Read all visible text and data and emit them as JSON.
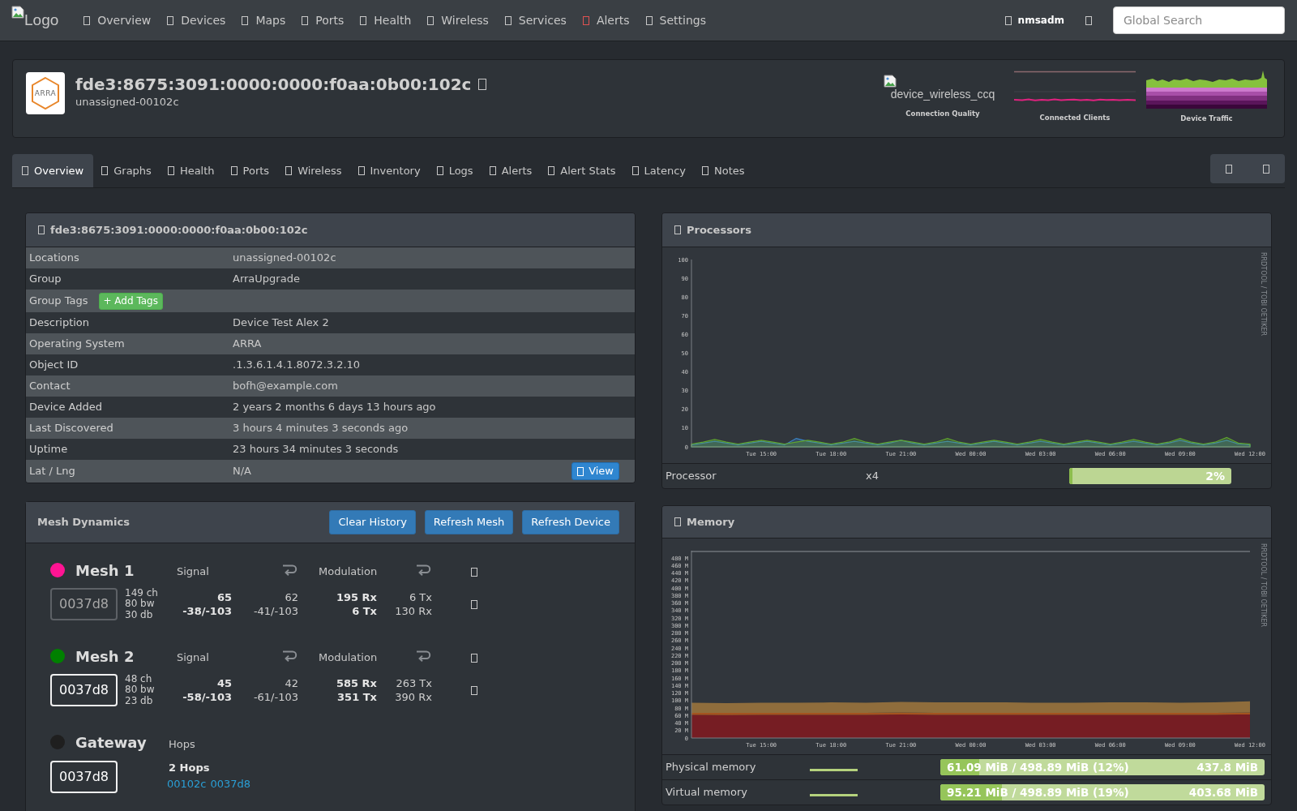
{
  "navbar": {
    "logo_alt": "Logo",
    "items": [
      {
        "label": "Overview",
        "color": "#c8c8c8"
      },
      {
        "label": "Devices",
        "color": "#c8c8c8"
      },
      {
        "label": "Maps",
        "color": "#c8c8c8"
      },
      {
        "label": "Ports",
        "color": "#c8c8c8"
      },
      {
        "label": "Health",
        "color": "#c8c8c8"
      },
      {
        "label": "Wireless",
        "color": "#c8c8c8"
      },
      {
        "label": "Services",
        "color": "#c8c8c8"
      },
      {
        "label": "Alerts",
        "color": "#e05252"
      },
      {
        "label": "Settings",
        "color": "#c8c8c8"
      }
    ],
    "user": "nmsadm",
    "search": {
      "placeholder": "Global Search"
    }
  },
  "device_header": {
    "logo_text": "ARRA",
    "title": "fde3:8675:3091:0000:0000:f0aa:0b00:102c",
    "subtitle": "unassigned-00102c",
    "graphs": [
      {
        "kind": "broken_image",
        "alt": "device_wireless_ccq",
        "label": "Connection Quality"
      },
      {
        "kind": "clients",
        "label": "Connected Clients"
      },
      {
        "kind": "traffic",
        "label": "Device Traffic"
      }
    ]
  },
  "tabs": [
    {
      "label": "Overview",
      "selected": true
    },
    {
      "label": "Graphs",
      "selected": false
    },
    {
      "label": "Health",
      "selected": false
    },
    {
      "label": "Ports",
      "selected": false
    },
    {
      "label": "Wireless",
      "selected": false
    },
    {
      "label": "Inventory",
      "selected": false
    },
    {
      "label": "Logs",
      "selected": false
    },
    {
      "label": "Alerts",
      "selected": false
    },
    {
      "label": "Alert Stats",
      "selected": false
    },
    {
      "label": "Latency",
      "selected": false
    },
    {
      "label": "Notes",
      "selected": false
    }
  ],
  "overview_panel": {
    "title": "fde3:8675:3091:0000:0000:f0aa:0b00:102c",
    "rows": [
      {
        "kind": "field",
        "label": "Locations",
        "value": "unassigned-00102c"
      },
      {
        "kind": "field",
        "label": "Group",
        "value": "ArraUpgrade"
      },
      {
        "kind": "tags",
        "label": "Group Tags",
        "button": "+ Add Tags"
      },
      {
        "kind": "field",
        "label": "Description",
        "value": "Device Test Alex 2"
      },
      {
        "kind": "field",
        "label": "Operating System",
        "value": "ARRA"
      },
      {
        "kind": "field",
        "label": "Object ID",
        "value": ".1.3.6.1.4.1.8072.3.2.10"
      },
      {
        "kind": "field",
        "label": "Contact",
        "value": "bofh@example.com"
      },
      {
        "kind": "field",
        "label": "Device Added",
        "value": "2 years 2 months 6 days 13 hours ago"
      },
      {
        "kind": "field",
        "label": "Last Discovered",
        "value": "3 hours 4 minutes 3 seconds ago"
      },
      {
        "kind": "field",
        "label": "Uptime",
        "value": "23 hours 34 minutes 3 seconds"
      },
      {
        "kind": "location",
        "label": "Lat / Lng",
        "value": "N/A",
        "button": "View"
      }
    ]
  },
  "mesh_panel": {
    "title": "Mesh Dynamics",
    "buttons": [
      "Clear History",
      "Refresh Mesh",
      "Refresh Device"
    ],
    "nodes": [
      {
        "kind": "link",
        "name": "Mesh 1",
        "color": "#ff1493",
        "node": "0037d8",
        "active": false,
        "signal_label": "Signal",
        "modulation_label": "Modulation",
        "details": [
          "149 ch",
          "80 bw",
          "30 db"
        ],
        "signal": {
          "current": [
            "65",
            "-38/-103"
          ],
          "previous": [
            "62",
            "-41/-103"
          ]
        },
        "modulation": {
          "current": [
            "195 Rx",
            "6 Tx"
          ],
          "previous": [
            "6 Tx",
            "130 Rx"
          ]
        }
      },
      {
        "kind": "link",
        "name": "Mesh 2",
        "color": "#008000",
        "node": "0037d8",
        "active": true,
        "signal_label": "Signal",
        "modulation_label": "Modulation",
        "details": [
          "48 ch",
          "80 bw",
          "23 db"
        ],
        "signal": {
          "current": [
            "45",
            "-58/-103"
          ],
          "previous": [
            "42",
            "-61/-103"
          ]
        },
        "modulation": {
          "current": [
            "585 Rx",
            "351 Tx"
          ],
          "previous": [
            "263 Tx",
            "390 Rx"
          ]
        }
      },
      {
        "kind": "gateway",
        "name": "Gateway",
        "color": "#1f1f1f",
        "node": "0037d8",
        "active": true,
        "hops_label": "Hops",
        "hops": "2 Hops",
        "path": [
          "00102c",
          "0037d8"
        ]
      }
    ]
  },
  "processors_panel": {
    "title": "Processors",
    "credit": "RRDTOOL / TOBI OETIKER",
    "chart_data": {
      "type": "area",
      "categories": [
        null,
        null,
        null,
        null,
        null,
        null,
        "Tue 15:00",
        null,
        null,
        null,
        null,
        null,
        "Tue 18:00",
        null,
        null,
        null,
        null,
        null,
        "Tue 21:00",
        null,
        null,
        null,
        null,
        null,
        "Wed 00:00",
        null,
        null,
        null,
        null,
        null,
        "Wed 03:00",
        null,
        null,
        null,
        null,
        null,
        "Wed 06:00",
        null,
        null,
        null,
        null,
        null,
        "Wed 09:00",
        null,
        null,
        null,
        null,
        null,
        "Wed 12:00"
      ],
      "ylim": [
        0,
        100
      ],
      "yticks": [
        0,
        10,
        20,
        30,
        40,
        50,
        60,
        70,
        80,
        90,
        100
      ],
      "series": [
        {
          "color": "#3b86c9",
          "values": [
            1,
            2,
            3,
            2,
            1,
            2,
            3,
            2,
            1,
            4.5,
            3,
            2,
            1,
            2,
            3,
            2,
            1,
            2,
            3.5,
            2,
            1,
            2,
            3,
            2,
            1,
            2,
            3,
            2,
            1,
            2,
            3,
            2,
            1,
            2,
            3,
            2,
            1,
            2,
            3,
            2,
            1,
            2,
            3.5,
            2,
            1,
            2,
            3.5,
            1.5,
            1
          ]
        },
        {
          "color": "#5fa62f",
          "values": [
            1.5,
            2.5,
            4,
            2.5,
            1.5,
            2.5,
            3.5,
            2.5,
            1.5,
            2.5,
            3.5,
            2.5,
            1.5,
            2.5,
            4.5,
            2.5,
            1.5,
            2.5,
            3.5,
            2.5,
            1.5,
            2.5,
            4.5,
            2.5,
            1.5,
            2.5,
            3.5,
            2.5,
            1.5,
            2.5,
            4,
            2.5,
            1.5,
            2.5,
            3.5,
            2.5,
            1.5,
            2.5,
            4,
            2.5,
            1.5,
            2.5,
            4.5,
            2.5,
            1.5,
            2.5,
            5,
            2,
            1.5
          ]
        }
      ]
    },
    "rows": [
      {
        "name": "Processor",
        "count": "x4",
        "level": 0.02,
        "reading": "2%"
      }
    ]
  },
  "memory_panel": {
    "title": "Memory",
    "credit": "RRDTOOL / TOBI OETIKER",
    "limit_line": true,
    "chart_data": {
      "type": "area",
      "stacked": true,
      "categories": [
        null,
        null,
        "Tue 15:00",
        null,
        "Tue 18:00",
        null,
        "Tue 21:00",
        null,
        "Wed 00:00",
        null,
        "Wed 03:00",
        null,
        "Wed 06:00",
        null,
        "Wed 09:00",
        null,
        "Wed 12:00"
      ],
      "ylim": [
        0,
        500
      ],
      "yticks": [
        {
          "value": 0,
          "label": "0"
        },
        {
          "value": 20,
          "label": "20 M"
        },
        {
          "value": 40,
          "label": "40 M"
        },
        {
          "value": 60,
          "label": "60 M"
        },
        {
          "value": 80,
          "label": "80 M"
        },
        {
          "value": 100,
          "label": "100 M"
        },
        {
          "value": 120,
          "label": "120 M"
        },
        {
          "value": 140,
          "label": "140 M"
        },
        {
          "value": 160,
          "label": "160 M"
        },
        {
          "value": 180,
          "label": "180 M"
        },
        {
          "value": 200,
          "label": "200 M"
        },
        {
          "value": 220,
          "label": "220 M"
        },
        {
          "value": 240,
          "label": "240 M"
        },
        {
          "value": 260,
          "label": "260 M"
        },
        {
          "value": 280,
          "label": "280 M"
        },
        {
          "value": 300,
          "label": "300 M"
        },
        {
          "value": 320,
          "label": "320 M"
        },
        {
          "value": 340,
          "label": "340 M"
        },
        {
          "value": 360,
          "label": "360 M"
        },
        {
          "value": 380,
          "label": "380 M"
        },
        {
          "value": 400,
          "label": "400 M"
        },
        {
          "value": 420,
          "label": "420 M"
        },
        {
          "value": 440,
          "label": "440 M"
        },
        {
          "value": 460,
          "label": "460 M"
        },
        {
          "value": 480,
          "label": "480 M"
        }
      ],
      "series": [
        {
          "color": "#761d23",
          "values": [
            62,
            61,
            62,
            62,
            62,
            62,
            63,
            62,
            62,
            62,
            62,
            62,
            62,
            62,
            62,
            62,
            63
          ]
        },
        {
          "color": "#a5531f",
          "values": [
            5,
            6,
            5,
            5,
            5,
            5,
            5,
            5,
            5,
            5,
            5,
            5,
            5,
            5,
            5,
            5,
            5
          ]
        },
        {
          "color": "#8f6d3c",
          "values": [
            27,
            26,
            27,
            27,
            28,
            27,
            28,
            28,
            28,
            28,
            27,
            27,
            28,
            28,
            27,
            28,
            30
          ]
        }
      ]
    },
    "rows": [
      {
        "name": "Physical memory",
        "level": 0.12,
        "reading": "61.09 MiB / 498.89 MiB (12%)",
        "free": "437.8 MiB"
      },
      {
        "name": "Virtual memory",
        "level": 0.19,
        "reading": "95.21 MiB / 498.89 MiB (19%)",
        "free": "403.68 MiB"
      }
    ]
  }
}
